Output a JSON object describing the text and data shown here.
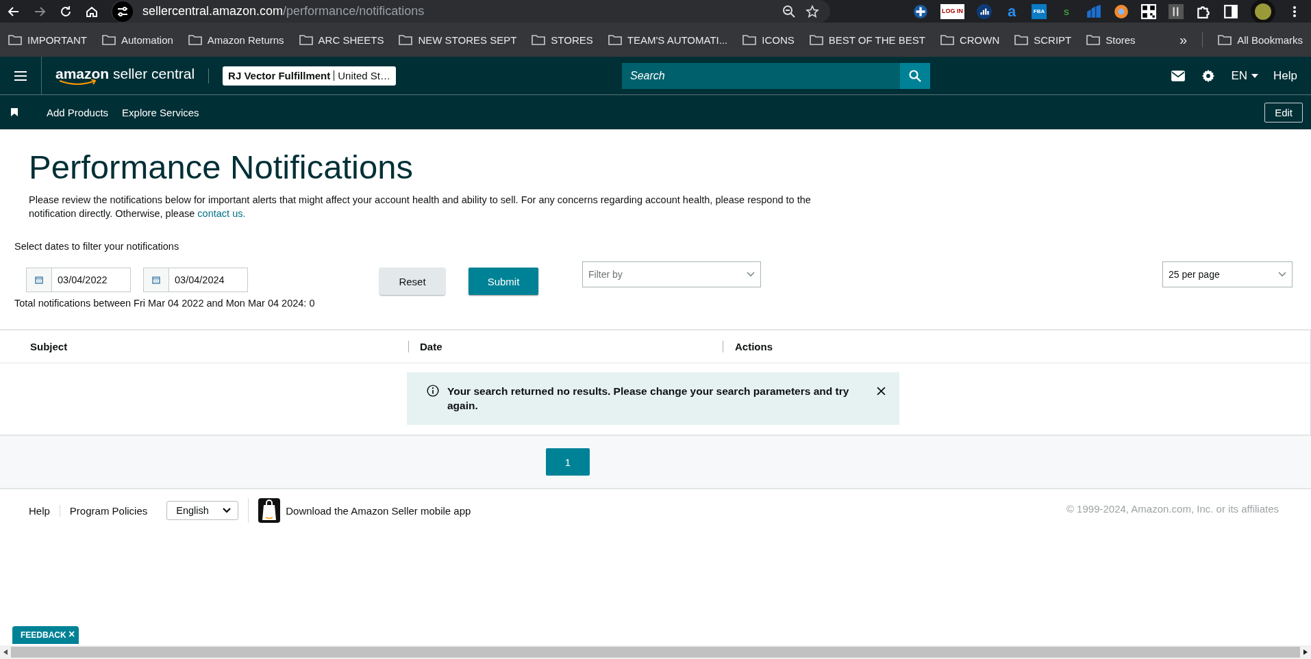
{
  "browser": {
    "url_host": "sellercentral.amazon.com",
    "url_path": "/performance/notifications",
    "extensions": [
      {
        "kind": "cross"
      },
      {
        "kind": "login",
        "label": "LOG IN"
      },
      {
        "kind": "bars"
      },
      {
        "kind": "amazon",
        "label": "a"
      },
      {
        "kind": "fba",
        "label": "FBA"
      },
      {
        "kind": "letter",
        "label": "s"
      },
      {
        "kind": "chart"
      },
      {
        "kind": "circle"
      },
      {
        "kind": "qr"
      },
      {
        "kind": "pause"
      },
      {
        "kind": "puzzle"
      }
    ],
    "bookmarks": [
      "IMPORTANT",
      "Automation",
      "Amazon Returns",
      "ARC SHEETS",
      "NEW STORES SEPT",
      "STORES",
      "TEAM'S AUTOMATI...",
      "ICONS",
      "BEST OF THE BEST",
      "CROWN",
      "SCRIPT",
      "Stores"
    ],
    "overflow": "»",
    "all_bookmarks": "All Bookmarks"
  },
  "header": {
    "logo_brand": "amazon",
    "logo_product": "seller central",
    "account_name": "RJ Vector Fulfillment",
    "account_region": "United St…",
    "search": {
      "placeholder": "Search"
    },
    "language": "EN",
    "help": "Help"
  },
  "subnav": {
    "links": [
      "Add Products",
      "Explore Services"
    ],
    "edit": "Edit"
  },
  "page": {
    "title": "Performance Notifications",
    "intro": "Please review the notifications below for important alerts that might affect your account health and ability to sell. For any concerns regarding account health, please respond to the notification directly. Otherwise, please ",
    "intro_link": "contact us.",
    "filter_label": "Select dates to filter your notifications",
    "start_date": "03/04/2022",
    "end_date": "03/04/2024",
    "reset": "Reset",
    "submit": "Submit",
    "filter_by": {
      "placeholder": "Filter by"
    },
    "per_page": "25 per page",
    "total": "Total notifications between Fri Mar 04 2022 and Mon Mar 04 2024: 0"
  },
  "table": {
    "columns": [
      "Subject",
      "Date",
      "Actions"
    ],
    "alert": "Your search returned no results. Please change your search parameters and try again."
  },
  "pagination": [
    {
      "label": "1",
      "selected": true
    }
  ],
  "footer": {
    "links": [
      "Help",
      "Program Policies"
    ],
    "language": "English",
    "app_link": "Download the Amazon Seller mobile app",
    "copyright": "© 1999-2024, Amazon.com, Inc. or its affiliates"
  },
  "feedback": {
    "label": "FEEDBACK",
    "close": "×"
  }
}
